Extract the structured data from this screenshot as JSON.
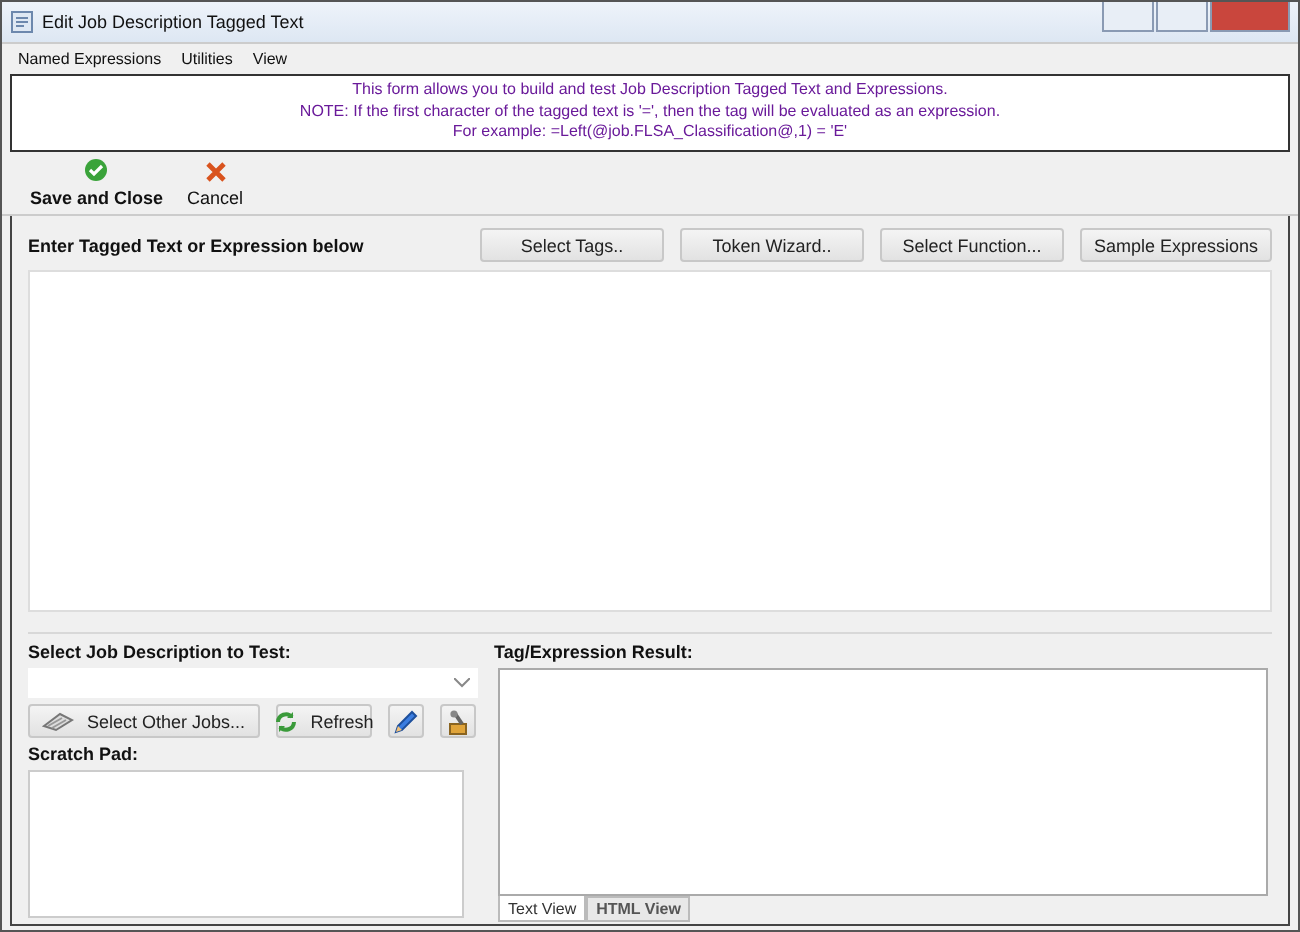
{
  "window": {
    "title": "Edit Job Description Tagged Text"
  },
  "menu": [
    "Named Expressions",
    "Utilities",
    "View"
  ],
  "info": [
    "This form allows you to build and test Job Description Tagged Text and Expressions.",
    "NOTE: If the first character of the tagged text is '=', then the tag will be evaluated as an expression.",
    "For example: =Left(@job.FLSA_Classification@,1) = 'E'"
  ],
  "toolbar": [
    {
      "kind": "save",
      "label": "Save and Close"
    },
    {
      "kind": "cancel",
      "label": "Cancel"
    }
  ],
  "editor": {
    "label": "Enter Tagged Text or Expression below",
    "buttons": [
      "Select Tags..",
      "Token Wizard..",
      "Select Function...",
      "Sample Expressions"
    ]
  },
  "job": {
    "label": "Select Job Description to Test:",
    "buttons": [
      {
        "kind": "jobs",
        "label": "Select Other Jobs..."
      },
      {
        "kind": "refresh",
        "label": "Refresh"
      },
      {
        "kind": "edit"
      },
      {
        "kind": "tool"
      }
    ]
  },
  "scratch": {
    "label": "Scratch Pad:"
  },
  "result": {
    "label": "Tag/Expression Result:",
    "tabs": [
      {
        "label": "Text View",
        "selected": true
      },
      {
        "label": "HTML View",
        "selected": false
      }
    ]
  }
}
